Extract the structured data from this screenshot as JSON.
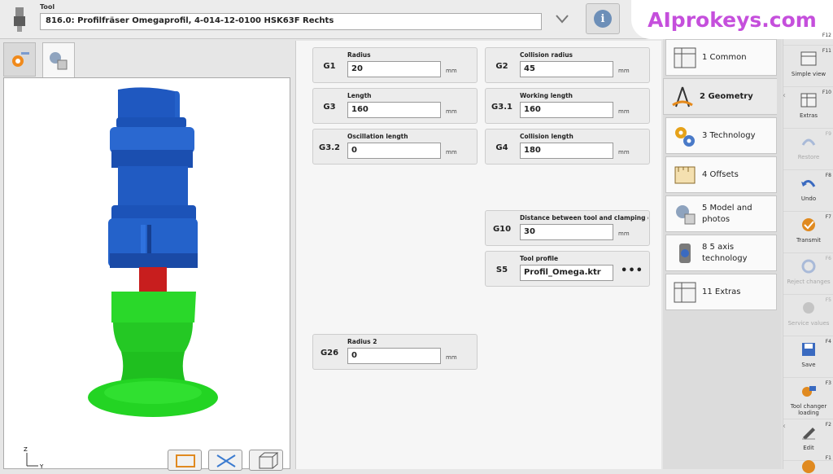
{
  "header": {
    "tool_label": "Tool",
    "tool_value": "816.0: Profilfräser Omegaprofil, 4-014-12-0100 HSK63F Rechts",
    "watermark": "AIprokeys.com"
  },
  "fields": [
    {
      "code": "G1",
      "label": "Radius",
      "value": "20",
      "unit": "mm"
    },
    {
      "code": "G2",
      "label": "Collision radius",
      "value": "45",
      "unit": "mm"
    },
    {
      "code": "G3",
      "label": "Length",
      "value": "160",
      "unit": "mm"
    },
    {
      "code": "G3.1",
      "label": "Working length",
      "value": "160",
      "unit": "mm"
    },
    {
      "code": "G3.2",
      "label": "Oscillation length",
      "value": "0",
      "unit": "mm"
    },
    {
      "code": "G4",
      "label": "Collision length",
      "value": "180",
      "unit": "mm"
    },
    {
      "code": "G10",
      "label": "Distance between tool and clamping eq...",
      "value": "30",
      "unit": "mm"
    },
    {
      "code": "S5",
      "label": "Tool profile",
      "value": "Profil_Omega.ktr",
      "more": "•••"
    },
    {
      "code": "G26",
      "label": "Radius 2",
      "value": "0",
      "unit": "mm"
    }
  ],
  "nav_tabs": [
    {
      "label": "1 Common",
      "icon": "common-table-icon"
    },
    {
      "label": "2 Geometry",
      "icon": "compass-icon",
      "active": true
    },
    {
      "label": "3 Technology",
      "icon": "gears-icon"
    },
    {
      "label": "4 Offsets",
      "icon": "ruler-icon"
    },
    {
      "label": "5 Model and photos",
      "icon": "model-photo-icon"
    },
    {
      "label": "8 5 axis technology",
      "icon": "five-axis-icon"
    },
    {
      "label": "11 Extras",
      "icon": "extras-table-icon"
    }
  ],
  "actions": [
    {
      "key": "F12",
      "label": ""
    },
    {
      "key": "F11",
      "label": "Simple view"
    },
    {
      "key": "F10",
      "label": "Extras"
    },
    {
      "key": "F9",
      "label": "Restore",
      "disabled": true
    },
    {
      "key": "F8",
      "label": "Undo"
    },
    {
      "key": "F7",
      "label": "Transmit"
    },
    {
      "key": "F6",
      "label": "Reject changes",
      "disabled": true
    },
    {
      "key": "F5",
      "label": "Service values",
      "disabled": true
    },
    {
      "key": "F4",
      "label": "Save"
    },
    {
      "key": "F3",
      "label": "Tool changer loading"
    },
    {
      "key": "F2",
      "label": "Edit"
    },
    {
      "key": "F1",
      "label": ""
    }
  ],
  "axis": {
    "z": "Z",
    "y": "Y"
  },
  "colors": {
    "tool_blue": "#1f5fc4",
    "tool_red": "#c81e1e",
    "tool_green": "#22dd22",
    "badge_text": "#c54fdc"
  }
}
